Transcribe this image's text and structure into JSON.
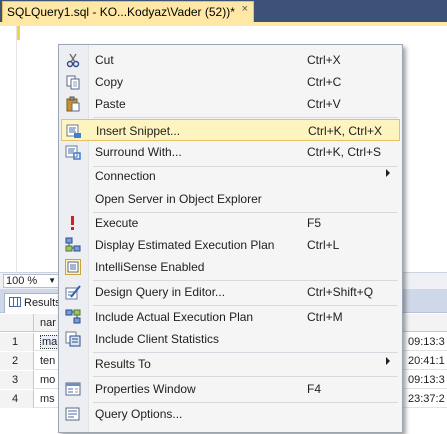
{
  "window": {
    "tab_title": "SQLQuery1.sql - KO...Kodyaz\\Vader (52))*",
    "tab_close": "×"
  },
  "editor": {
    "zoom": "100 %"
  },
  "results": {
    "tab_label": "Results",
    "column_header": "nar",
    "rows": [
      {
        "num": "1",
        "name": "ma",
        "time": "09:13:3"
      },
      {
        "num": "2",
        "name": "ten",
        "time": "20:41:1"
      },
      {
        "num": "3",
        "name": "mo",
        "time": "09:13:3"
      },
      {
        "num": "4",
        "name": "ms",
        "time": "23:37:2"
      }
    ]
  },
  "context_menu": {
    "items": [
      {
        "label": "Cut",
        "shortcut": "Ctrl+X",
        "icon": "scissors-icon"
      },
      {
        "label": "Copy",
        "shortcut": "Ctrl+C",
        "icon": "copy-icon"
      },
      {
        "label": "Paste",
        "shortcut": "Ctrl+V",
        "icon": "paste-icon"
      },
      {
        "label": "Insert Snippet...",
        "shortcut": "Ctrl+K, Ctrl+X",
        "icon": "insert-snippet-icon",
        "highlighted": true
      },
      {
        "label": "Surround With...",
        "shortcut": "Ctrl+K, Ctrl+S",
        "icon": "surround-with-icon"
      },
      {
        "label": "Connection",
        "shortcut": "",
        "submenu": true
      },
      {
        "label": "Open Server in Object Explorer",
        "shortcut": ""
      },
      {
        "label": "Execute",
        "shortcut": "F5",
        "icon": "execute-icon"
      },
      {
        "label": "Display Estimated Execution Plan",
        "shortcut": "Ctrl+L",
        "icon": "execution-plan-icon"
      },
      {
        "label": "IntelliSense Enabled",
        "shortcut": "",
        "icon": "intellisense-icon"
      },
      {
        "label": "Design Query in Editor...",
        "shortcut": "Ctrl+Shift+Q",
        "icon": "design-query-icon"
      },
      {
        "label": "Include Actual Execution Plan",
        "shortcut": "Ctrl+M",
        "icon": "actual-plan-icon"
      },
      {
        "label": "Include Client Statistics",
        "shortcut": "",
        "icon": "client-statistics-icon"
      },
      {
        "label": "Results To",
        "shortcut": "",
        "submenu": true
      },
      {
        "label": "Properties Window",
        "shortcut": "F4",
        "icon": "properties-icon"
      },
      {
        "label": "Query Options...",
        "shortcut": "",
        "icon": "query-options-icon"
      }
    ]
  },
  "colors": {
    "title_bar": "#3d5277",
    "active_tab": "#ffe8a6",
    "menu_highlight": "#fdf4bf",
    "menu_highlight_border": "#e5c365"
  }
}
